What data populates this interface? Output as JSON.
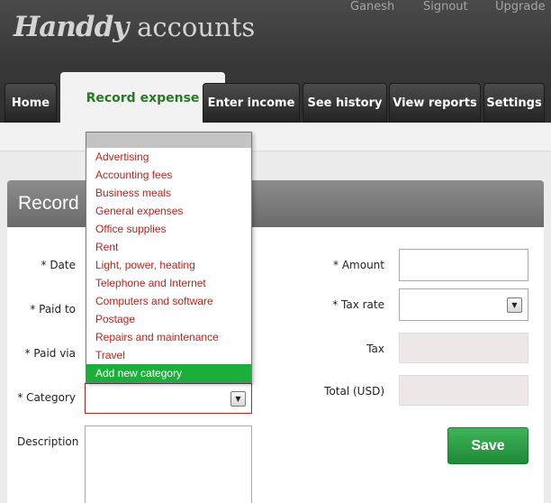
{
  "app": {
    "logo_part1": "Handdy",
    "logo_part2": "accounts"
  },
  "top_links": [
    "Ganesh",
    "Signout",
    "Upgrade"
  ],
  "tabs": [
    "Home",
    "Record expense",
    "Enter income",
    "See history",
    "View reports",
    "Settings"
  ],
  "panel": {
    "title": "Record"
  },
  "form": {
    "date_label": "* Date",
    "paid_to_label": "* Paid to",
    "paid_via_label": "* Paid via",
    "category_label": "* Category",
    "description_label": "Description",
    "amount_label": "* Amount",
    "tax_rate_label": "* Tax rate",
    "tax_label": "Tax",
    "total_label": "Total (USD)",
    "save_label": "Save"
  },
  "category_dropdown": {
    "options": [
      "Advertising",
      "Accounting fees",
      "Business meals",
      "General expenses",
      "Office supplies",
      "Rent",
      "Light, power, heating",
      "Telephone and Internet",
      "Computers and software",
      "Postage",
      "Repairs and maintenance",
      "Travel",
      "Add new category"
    ],
    "highlighted": "Add new category"
  },
  "icons": {
    "select_arrow": "chevron-down-icon"
  },
  "colors": {
    "active_tab_text": "#267a26",
    "option_text": "#c0211b",
    "highlight": "#1cae3a",
    "save": "#2a9e45"
  }
}
